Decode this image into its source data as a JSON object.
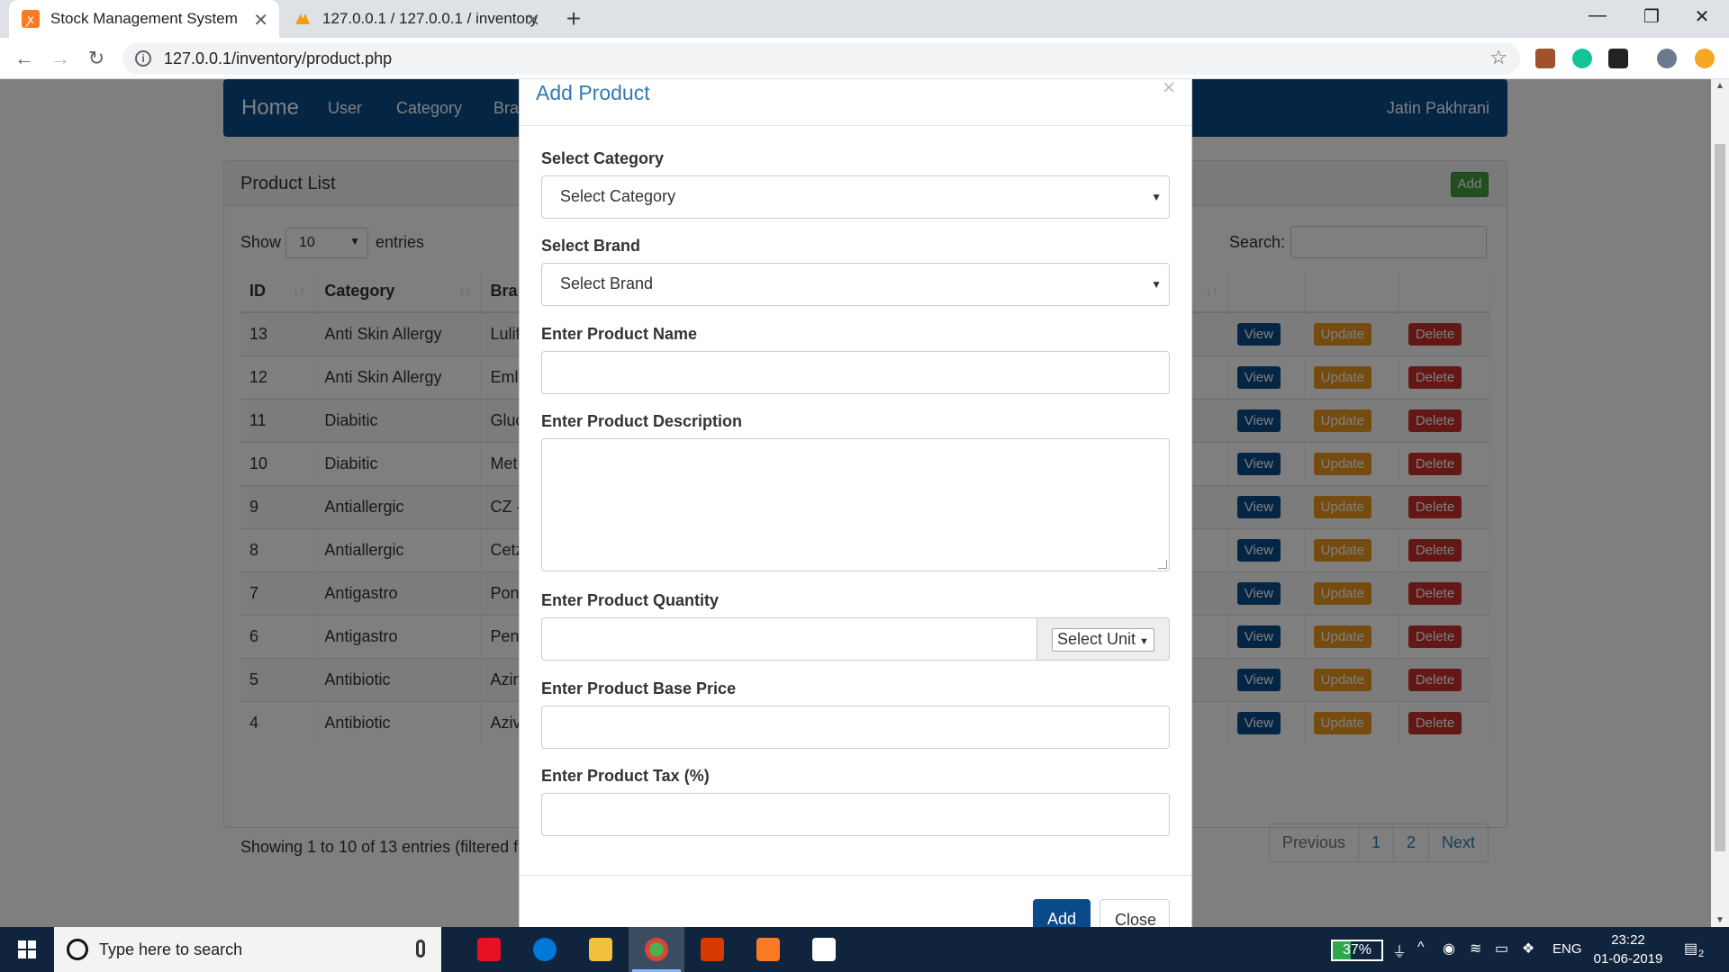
{
  "browser": {
    "tabs": [
      {
        "title": "Stock Management System"
      },
      {
        "title": "127.0.0.1 / 127.0.0.1 / inventory /"
      }
    ],
    "url": "127.0.0.1/inventory/product.php"
  },
  "navbar": {
    "brand": "Home",
    "items": [
      "User",
      "Category",
      "Bra"
    ],
    "user": "Jatin Pakhrani"
  },
  "panel": {
    "title": "Product List",
    "add_label": "Add",
    "show_label": "Show",
    "page_length": "10",
    "entries_label": "entries",
    "search_label": "Search:",
    "columns": [
      "ID",
      "Category",
      "Bra"
    ],
    "rows": [
      {
        "id": "13",
        "category": "Anti Skin Allergy",
        "brand": "Lulif"
      },
      {
        "id": "12",
        "category": "Anti Skin Allergy",
        "brand": "Eml"
      },
      {
        "id": "11",
        "category": "Diabitic",
        "brand": "Gluc"
      },
      {
        "id": "10",
        "category": "Diabitic",
        "brand": "Met"
      },
      {
        "id": "9",
        "category": "Antiallergic",
        "brand": "CZ -"
      },
      {
        "id": "8",
        "category": "Antiallergic",
        "brand": "Cetz"
      },
      {
        "id": "7",
        "category": "Antigastro",
        "brand": "Pon"
      },
      {
        "id": "6",
        "category": "Antigastro",
        "brand": "Pen"
      },
      {
        "id": "5",
        "category": "Antibiotic",
        "brand": "Azin"
      },
      {
        "id": "4",
        "category": "Antibiotic",
        "brand": "Aziv"
      }
    ],
    "view_label": "View",
    "update_label": "Update",
    "delete_label": "Delete",
    "info": "Showing 1 to 10 of 13 entries (filtered fr",
    "pager": [
      "Previous",
      "1",
      "2",
      "Next"
    ]
  },
  "modal": {
    "title": "Add Product",
    "close_x": "×",
    "category_label": "Select Category",
    "category_value": "Select Category",
    "brand_label": "Select Brand",
    "brand_value": "Select Brand",
    "name_label": "Enter Product Name",
    "description_label": "Enter Product Description",
    "quantity_label": "Enter Product Quantity",
    "unit_value": "Select Unit",
    "base_price_label": "Enter Product Base Price",
    "tax_label": "Enter Product Tax (%)",
    "add_button": "Add",
    "close_button": "Close"
  },
  "taskbar": {
    "search_placeholder": "Type here to search",
    "battery": "37%",
    "battery_level": 0.37,
    "language": "ENG",
    "time": "23:22",
    "date": "01-06-2019",
    "notifications": "2"
  },
  "colors": {
    "primary": "#0a4a8a",
    "update": "#ec971f",
    "delete": "#c9302c",
    "add": "#449d44",
    "link": "#337ab7"
  }
}
